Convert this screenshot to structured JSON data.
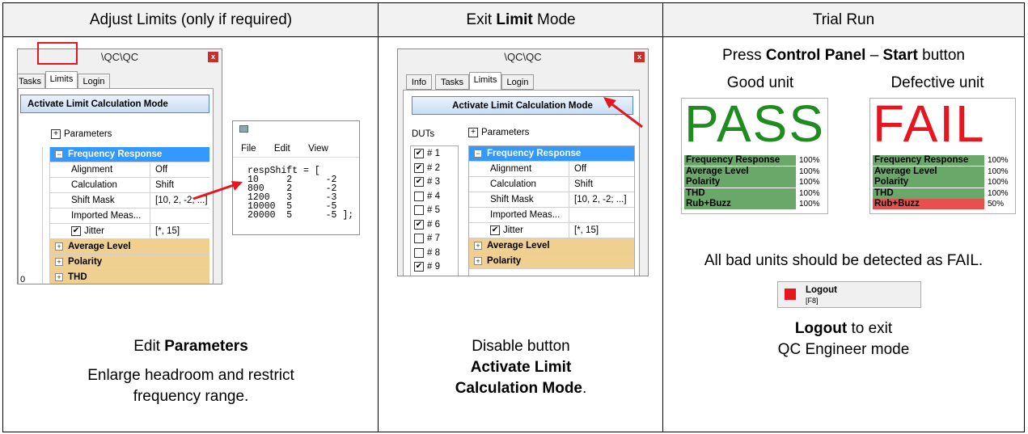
{
  "headers": [
    "Adjust Limits (only if required)",
    "Exit Limit Mode",
    "Trial Run"
  ],
  "header2_prefix": "Exit ",
  "header2_bold": "Limit",
  "header2_suffix": " Mode",
  "win1": {
    "title": "\\QC\\QC",
    "tabs": [
      "Tasks",
      "Limits",
      "Login"
    ],
    "activate_button": "Activate Limit Calculation Mode",
    "parameters": "Parameters",
    "left_value": "0",
    "rows": [
      {
        "k": "Frequency Response",
        "v": ""
      },
      {
        "k": "Alignment",
        "v": "Off"
      },
      {
        "k": "Calculation",
        "v": "Shift"
      },
      {
        "k": "Shift Mask",
        "v": "[10, 2, -2; ...]"
      },
      {
        "k": "Imported Meas...",
        "v": ""
      },
      {
        "k": "Jitter",
        "v": "[*, 15]"
      },
      {
        "k": "Average Level",
        "v": ""
      },
      {
        "k": "Polarity",
        "v": ""
      },
      {
        "k": "THD",
        "v": ""
      }
    ]
  },
  "editor": {
    "menu": [
      "File",
      "Edit",
      "View"
    ],
    "code": "respShift = [\n10     2      -2\n800    2      -2\n1200   3      -3\n10000  5      -5\n20000  5      -5 ];"
  },
  "win2": {
    "title": "\\QC\\QC",
    "tabs": [
      "Info",
      "Tasks",
      "Limits",
      "Login"
    ],
    "activate_button": "Activate Limit Calculation Mode",
    "duts_label": "DUTs",
    "parameters": "Parameters",
    "duts": [
      {
        "label": "# 1",
        "checked": true
      },
      {
        "label": "# 2",
        "checked": true
      },
      {
        "label": "# 3",
        "checked": true
      },
      {
        "label": "# 4",
        "checked": false
      },
      {
        "label": "# 5",
        "checked": false
      },
      {
        "label": "# 6",
        "checked": true
      },
      {
        "label": "# 7",
        "checked": false
      },
      {
        "label": "# 8",
        "checked": false
      },
      {
        "label": "# 9",
        "checked": true
      }
    ],
    "rows": [
      {
        "k": "Frequency Response",
        "v": ""
      },
      {
        "k": "Alignment",
        "v": "Off"
      },
      {
        "k": "Calculation",
        "v": "Shift"
      },
      {
        "k": "Shift Mask",
        "v": "[10, 2, -2; ...]"
      },
      {
        "k": "Imported Meas...",
        "v": ""
      },
      {
        "k": "Jitter",
        "v": "[*, 15]"
      },
      {
        "k": "Average Level",
        "v": ""
      },
      {
        "k": "Polarity",
        "v": ""
      }
    ]
  },
  "col1_caption": {
    "line1_prefix": "Edit ",
    "line1_bold": "Parameters",
    "line2": "Enlarge headroom and restrict",
    "line3": "frequency range."
  },
  "col2_caption": {
    "line1": "Disable button",
    "line2": "Activate Limit",
    "line3_bold": "Calculation Mode",
    "line3_suffix": "."
  },
  "col3": {
    "press_prefix": "Press ",
    "press_bold1": "Control Panel",
    "press_mid": " – ",
    "press_bold2": "Start",
    "press_suffix": " button",
    "good_label": "Good unit",
    "bad_label": "Defective unit",
    "pass_text": "PASS",
    "fail_text": "FAIL",
    "pass_rows": [
      {
        "n": "Frequency Response",
        "p": "100%"
      },
      {
        "n": "Average Level",
        "p": "100%"
      },
      {
        "n": "Polarity",
        "p": "100%"
      },
      {
        "n": "THD",
        "p": "100%"
      },
      {
        "n": "Rub+Buzz",
        "p": "100%"
      }
    ],
    "fail_rows": [
      {
        "n": "Frequency Response",
        "p": "100%",
        "ok": true
      },
      {
        "n": "Average Level",
        "p": "100%",
        "ok": true
      },
      {
        "n": "Polarity",
        "p": "100%",
        "ok": true
      },
      {
        "n": "THD",
        "p": "100%",
        "ok": true
      },
      {
        "n": "Rub+Buzz",
        "p": "50%",
        "ok": false
      }
    ],
    "detect_text": "All bad units should be detected as FAIL.",
    "logout_label": "Logout",
    "logout_key": "[F8]",
    "logout_bold": "Logout",
    "logout_suffix": " to exit",
    "logout_line2": "QC Engineer mode"
  },
  "colors": {
    "pass": "#1e8c1e",
    "fail": "#e8141e",
    "ok_row": "#6aa86a",
    "bad_row": "#e85050",
    "selected": "#3399ff",
    "group": "#f0d090"
  }
}
